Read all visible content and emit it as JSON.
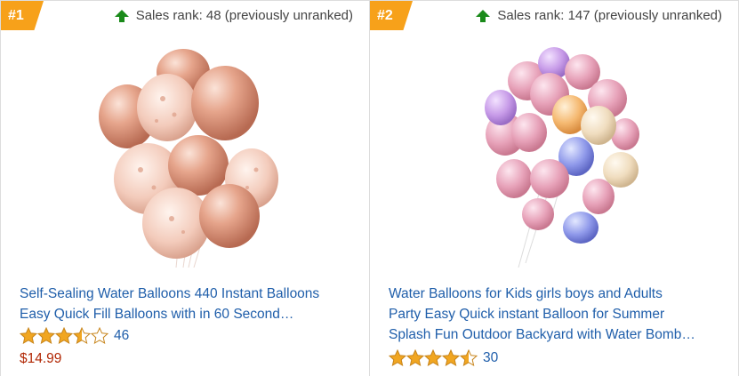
{
  "items": [
    {
      "rank": "#1",
      "sales_rank_text": "Sales rank: 48 (previously unranked)",
      "title_line1": "Self-Sealing Water Balloons 440 Instant Balloons",
      "title_line2": "Easy Quick Fill Balloons with in 60 Second…",
      "rating": 3.5,
      "rating_count": "46",
      "price": "$14.99"
    },
    {
      "rank": "#2",
      "sales_rank_text": "Sales rank: 147 (previously unranked)",
      "title_line1": "Water Balloons for Kids girls boys and Adults",
      "title_line2": "Party Easy Quick instant Balloon for Summer",
      "title_line3": "Splash Fun Outdoor Backyard with Water Bomb…",
      "rating": 4.5,
      "rating_count": "30"
    }
  ],
  "colors": {
    "badge": "#f7a11a",
    "arrow_up": "#1a8a1a",
    "link": "#1f5eaa",
    "price": "#b12704",
    "star": "#f1a621"
  },
  "icons": [
    "rank-up-arrow-icon",
    "star-icon",
    "half-star-icon",
    "empty-star-icon"
  ]
}
